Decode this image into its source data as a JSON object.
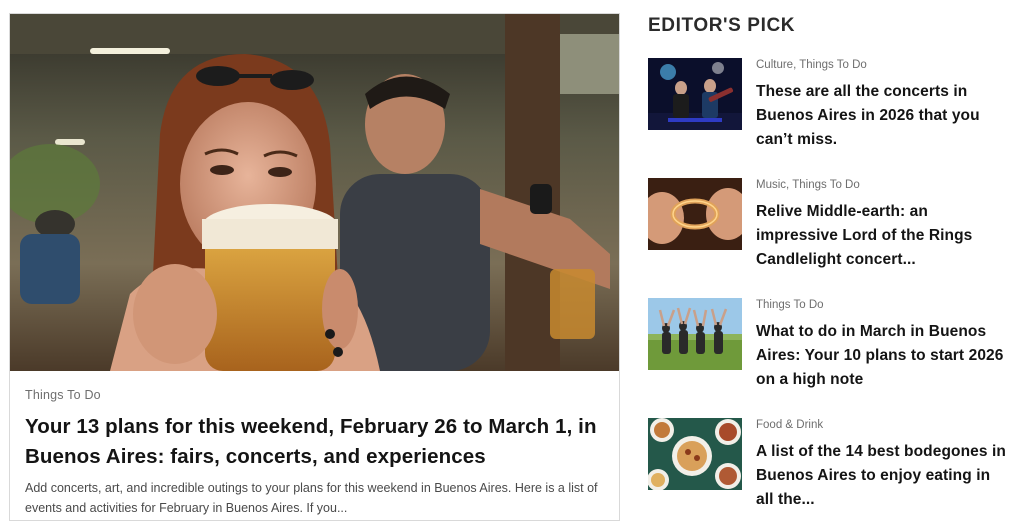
{
  "feature": {
    "category": "Things To Do",
    "title": "Your 13 plans for this weekend, February 26 to March 1, in Buenos Aires: fairs, concerts, and experiences",
    "excerpt": "Add concerts, art, and incredible outings to your plans for this weekend in Buenos Aires. Here is a list of events and activities for February in Buenos Aires. If you..."
  },
  "editors_pick": {
    "heading": "EDITOR'S PICK",
    "items": [
      {
        "category": "Culture, Things To Do",
        "title": "These are all the concerts in Buenos Aires in 2026 that you can’t miss."
      },
      {
        "category": "Music, Things To Do",
        "title": "Relive Middle-earth: an impressive Lord of the Rings Candlelight concert..."
      },
      {
        "category": "Things To Do",
        "title": "What to do in March in Buenos Aires: Your 10 plans to start 2026 on a high note"
      },
      {
        "category": "Food & Drink",
        "title": "A list of the 14 best bodegones in Buenos Aires to enjoy eating in all the..."
      }
    ]
  }
}
